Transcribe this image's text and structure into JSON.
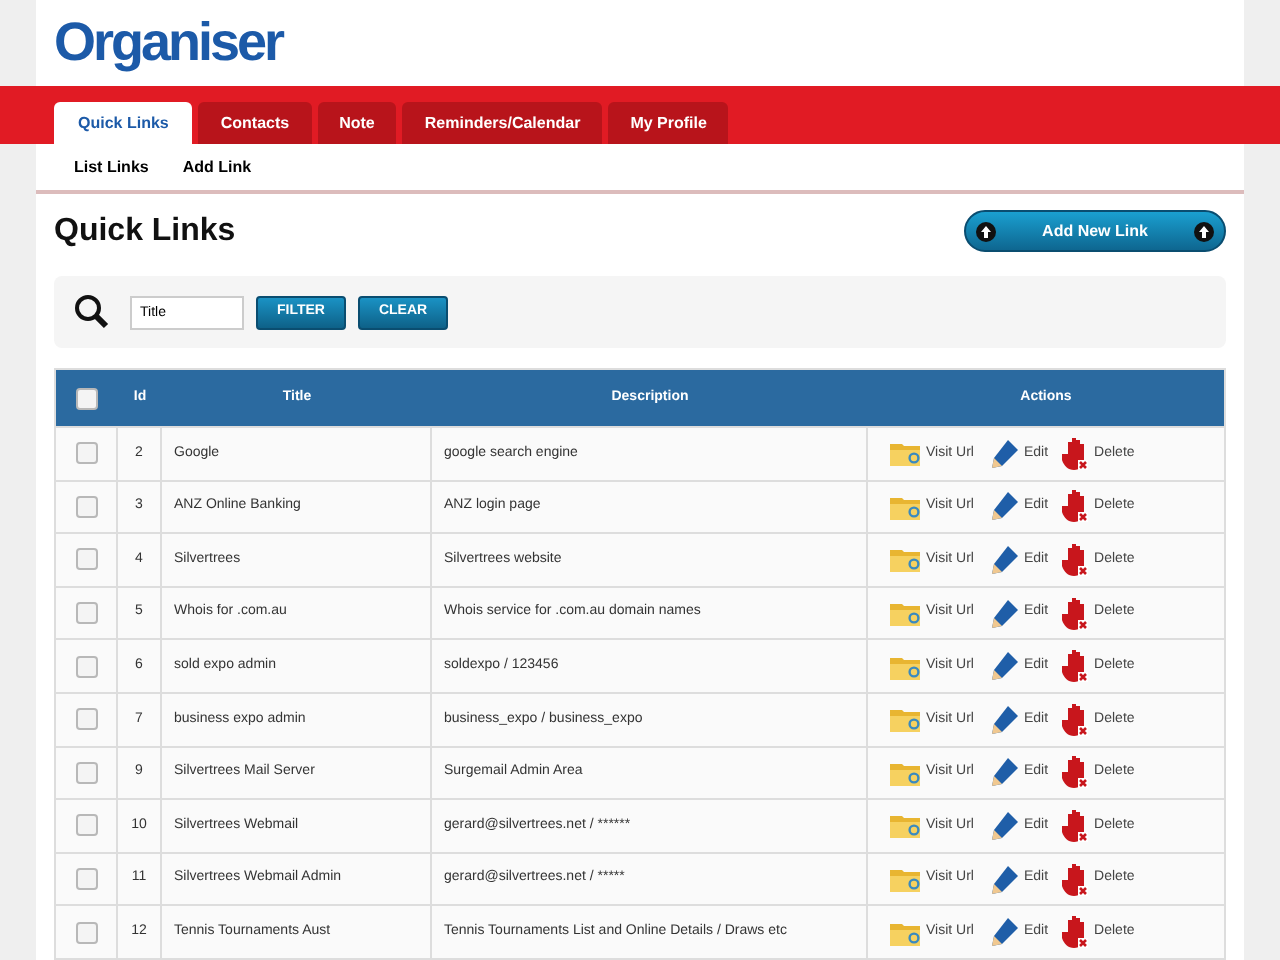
{
  "logo": "Organiser",
  "tabs": [
    {
      "label": "Quick Links",
      "selected": true
    },
    {
      "label": "Contacts",
      "selected": false
    },
    {
      "label": "Note",
      "selected": false
    },
    {
      "label": "Reminders/Calendar",
      "selected": false
    },
    {
      "label": "My Profile",
      "selected": false
    }
  ],
  "subnav": [
    "List Links",
    "Add Link"
  ],
  "heading": "Quick Links",
  "add_button": "Add New Link",
  "filter": {
    "value": "Title",
    "buttons": [
      "FILTER",
      "CLEAR"
    ]
  },
  "table": {
    "select_all_checked": false,
    "columns": [
      "Id",
      "Title",
      "Description",
      "Actions"
    ],
    "rows": [
      {
        "checked": false,
        "id": "2",
        "title": "Google",
        "description": "google search engine",
        "actions": [
          "Visit Url",
          "Edit",
          "Delete"
        ]
      },
      {
        "checked": false,
        "id": "3",
        "title": "ANZ Online Banking",
        "description": "ANZ login page",
        "actions": [
          "Visit Url",
          "Edit",
          "Delete"
        ]
      },
      {
        "checked": false,
        "id": "4",
        "title": "Silvertrees",
        "description": "Silvertrees website",
        "actions": [
          "Visit Url",
          "Edit",
          "Delete"
        ]
      },
      {
        "checked": false,
        "id": "5",
        "title": "Whois for .com.au",
        "description": "Whois service for .com.au domain names",
        "actions": [
          "Visit Url",
          "Edit",
          "Delete"
        ]
      },
      {
        "checked": false,
        "id": "6",
        "title": "sold expo admin",
        "description": "soldexpo / 123456",
        "actions": [
          "Visit Url",
          "Edit",
          "Delete"
        ]
      },
      {
        "checked": false,
        "id": "7",
        "title": "business expo admin",
        "description": "business_expo / business_expo",
        "actions": [
          "Visit Url",
          "Edit",
          "Delete"
        ]
      },
      {
        "checked": false,
        "id": "9",
        "title": "Silvertrees Mail Server",
        "description": "Surgemail Admin Area",
        "actions": [
          "Visit Url",
          "Edit",
          "Delete"
        ]
      },
      {
        "checked": false,
        "id": "10",
        "title": "Silvertrees Webmail",
        "description": "gerard@silvertrees.net / ******",
        "actions": [
          "Visit Url",
          "Edit",
          "Delete"
        ]
      },
      {
        "checked": false,
        "id": "11",
        "title": "Silvertrees Webmail Admin",
        "description": "gerard@silvertrees.net / *****",
        "actions": [
          "Visit Url",
          "Edit",
          "Delete"
        ]
      },
      {
        "checked": false,
        "id": "12",
        "title": "Tennis Tournaments Aust",
        "description": "Tennis Tournaments List and Online Details / Draws etc",
        "actions": [
          "Visit Url",
          "Edit",
          "Delete"
        ]
      }
    ]
  }
}
